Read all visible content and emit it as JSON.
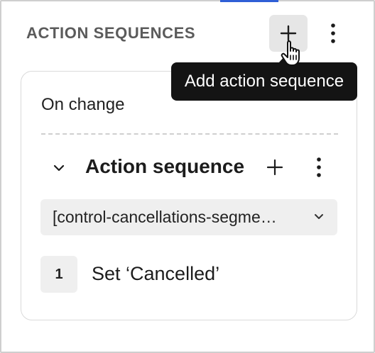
{
  "panel": {
    "title": "ACTION SEQUENCES",
    "add_icon": "plus-icon",
    "more_icon": "vertical-ellipsis-icon",
    "cursor_icon": "hand-pointer-icon"
  },
  "tooltip": {
    "text": "Add action sequence"
  },
  "trigger": {
    "label": "On change"
  },
  "sequence": {
    "title": "Action sequence",
    "collapse_icon": "chevron-down-icon",
    "add_icon": "plus-icon",
    "more_icon": "vertical-ellipsis-icon",
    "control_select": {
      "value": "[control-cancellations-segme…",
      "chevron_icon": "chevron-down-icon"
    },
    "steps": [
      {
        "number": "1",
        "label": "Set ‘Cancelled’"
      }
    ]
  },
  "colors": {
    "tooltip_bg": "#141414",
    "accent": "#2f5fd6",
    "control_bg": "#efefef"
  }
}
